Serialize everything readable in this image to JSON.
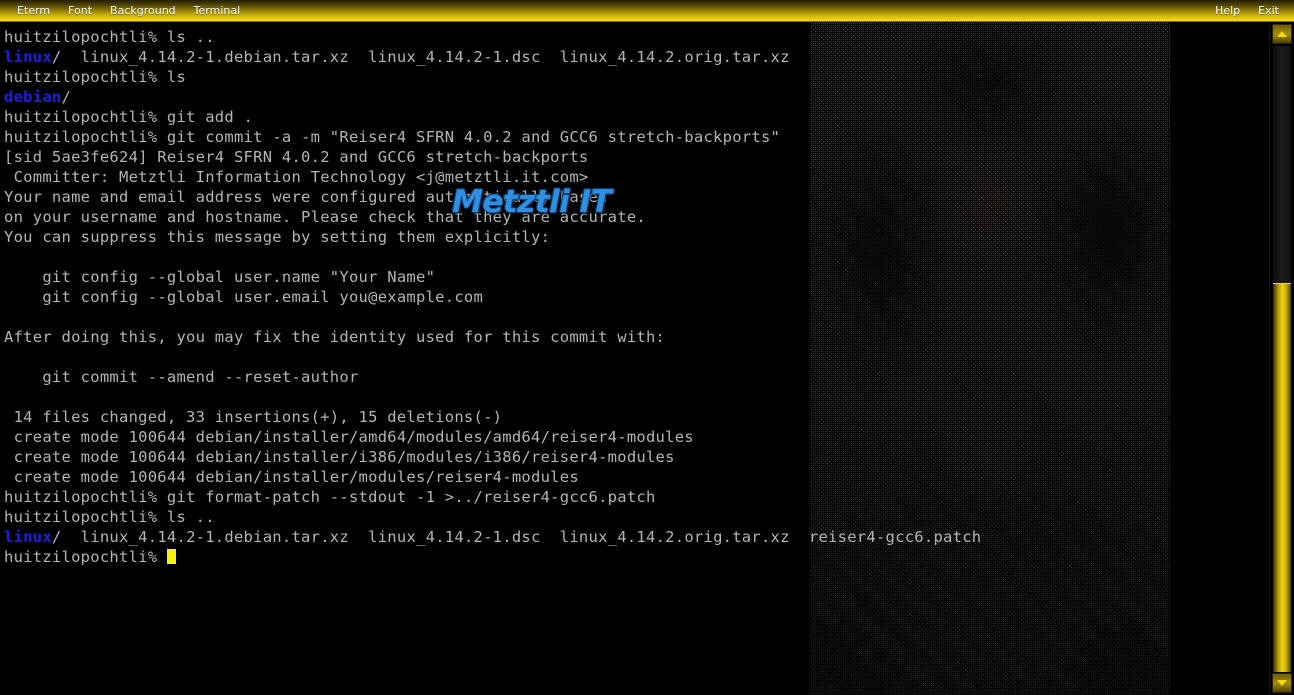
{
  "window": {
    "app_name": "Eterm",
    "menu_items": [
      {
        "label": "Eterm",
        "name": "menu-eterm"
      },
      {
        "label": "Font",
        "name": "menu-font"
      },
      {
        "label": "Background",
        "name": "menu-background"
      },
      {
        "label": "Terminal",
        "name": "menu-terminal"
      }
    ],
    "right_menu_items": [
      {
        "label": "Help",
        "name": "menu-help"
      },
      {
        "label": "Exit",
        "name": "menu-exit"
      }
    ]
  },
  "colors": {
    "titlebar_gradient_dark": "#241e02",
    "titlebar_gradient_light": "#f2d80e",
    "terminal_bg": "#000000",
    "terminal_fg": "#b4b4b4",
    "directory_fg": "#1f1fe0",
    "cursor": "#f2f20c",
    "scrollbar_thumb": "#f0d60e",
    "watermark": "#2f8fe0"
  },
  "watermark": {
    "text": "Metztli IT"
  },
  "terminal": {
    "prompt": "huitzilopochtli%",
    "lines": [
      {
        "text": "huitzilopochtli% ls .."
      },
      {
        "dir": "linux",
        "text": "/  linux_4.14.2-1.debian.tar.xz  linux_4.14.2-1.dsc  linux_4.14.2.orig.tar.xz"
      },
      {
        "text": "huitzilopochtli% ls"
      },
      {
        "dir": "debian",
        "text": "/"
      },
      {
        "text": "huitzilopochtli% git add ."
      },
      {
        "text": "huitzilopochtli% git commit -a -m \"Reiser4 SFRN 4.0.2 and GCC6 stretch-backports\""
      },
      {
        "text": "[sid 5ae3fe624] Reiser4 SFRN 4.0.2 and GCC6 stretch-backports"
      },
      {
        "text": " Committer: Metztli Information Technology <j@metztli.it.com>"
      },
      {
        "text": "Your name and email address were configured automatically based"
      },
      {
        "text": "on your username and hostname. Please check that they are accurate."
      },
      {
        "text": "You can suppress this message by setting them explicitly:"
      },
      {
        "text": ""
      },
      {
        "text": "    git config --global user.name \"Your Name\""
      },
      {
        "text": "    git config --global user.email you@example.com"
      },
      {
        "text": ""
      },
      {
        "text": "After doing this, you may fix the identity used for this commit with:"
      },
      {
        "text": ""
      },
      {
        "text": "    git commit --amend --reset-author"
      },
      {
        "text": ""
      },
      {
        "text": " 14 files changed, 33 insertions(+), 15 deletions(-)"
      },
      {
        "text": " create mode 100644 debian/installer/amd64/modules/amd64/reiser4-modules"
      },
      {
        "text": " create mode 100644 debian/installer/i386/modules/i386/reiser4-modules"
      },
      {
        "text": " create mode 100644 debian/installer/modules/reiser4-modules"
      },
      {
        "text": "huitzilopochtli% git format-patch --stdout -1 >../reiser4-gcc6.patch"
      },
      {
        "text": "huitzilopochtli% ls .."
      },
      {
        "dir": "linux",
        "text": "/  linux_4.14.2-1.debian.tar.xz  linux_4.14.2-1.dsc  linux_4.14.2.orig.tar.xz  reiser4-gcc6.patch"
      },
      {
        "text": "huitzilopochtli% ",
        "cursor": true
      }
    ]
  },
  "scrollbar": {
    "up_arrow": "scroll-up",
    "down_arrow": "scroll-down"
  }
}
